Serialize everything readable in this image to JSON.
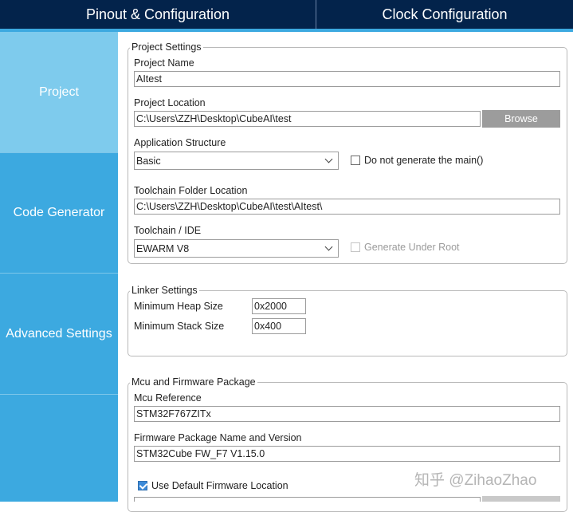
{
  "tabs": {
    "pinout": "Pinout & Configuration",
    "clock": "Clock Configuration"
  },
  "sidebar": {
    "items": [
      "Project",
      "Code Generator",
      "Advanced Settings",
      ""
    ]
  },
  "project_settings": {
    "legend": "Project Settings",
    "name_label": "Project Name",
    "name_value": "AItest",
    "location_label": "Project Location",
    "location_value": "C:\\Users\\ZZH\\Desktop\\CubeAI\\test",
    "browse": "Browse",
    "app_structure_label": "Application Structure",
    "app_structure_value": "Basic",
    "no_main_label": "Do not generate the main()",
    "toolchain_folder_label": "Toolchain Folder Location",
    "toolchain_folder_value": "C:\\Users\\ZZH\\Desktop\\CubeAI\\test\\AItest\\",
    "toolchain_label": "Toolchain / IDE",
    "toolchain_value": "EWARM V8",
    "gen_under_root_label": "Generate Under Root"
  },
  "linker": {
    "legend": "Linker Settings",
    "heap_label": "Minimum Heap Size",
    "heap_value": "0x2000",
    "stack_label": "Minimum Stack Size",
    "stack_value": "0x400"
  },
  "mcu": {
    "legend": "Mcu and Firmware Package",
    "ref_label": "Mcu Reference",
    "ref_value": "STM32F767ZITx",
    "fw_label": "Firmware Package Name and Version",
    "fw_value": "STM32Cube FW_F7 V1.15.0",
    "default_loc_label": "Use Default Firmware Location"
  },
  "watermark": "知乎 @ZihaoZhao",
  "colors": {
    "header": "#03234b",
    "sidebar": "#3ca9e0",
    "sidebar_active": "#7ecbed"
  }
}
